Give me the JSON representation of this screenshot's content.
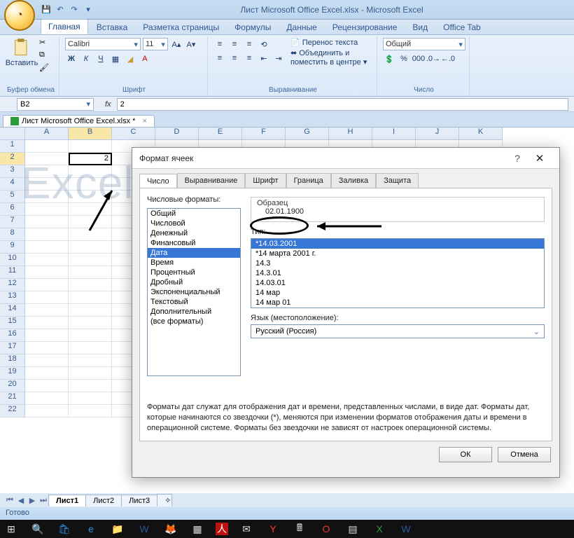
{
  "app": {
    "title": "Лист Microsoft Office Excel.xlsx - Microsoft Excel"
  },
  "ribbon": {
    "tabs": [
      "Главная",
      "Вставка",
      "Разметка страницы",
      "Формулы",
      "Данные",
      "Рецензирование",
      "Вид",
      "Office Tab"
    ],
    "active_tab": "Главная",
    "groups": {
      "clipboard": {
        "label": "Буфер обмена",
        "paste_label": "Вставить"
      },
      "font": {
        "label": "Шрифт",
        "font_name": "Calibri",
        "font_size": "11"
      },
      "alignment": {
        "label": "Выравнивание",
        "wrap_label": "Перенос текста",
        "merge_label": "Объединить и поместить в центре"
      },
      "number": {
        "label": "Число",
        "format": "Общий"
      }
    }
  },
  "formula_bar": {
    "name_box": "B2",
    "fx_label": "fx",
    "value": "2"
  },
  "workbook_tab": "Лист Microsoft Office Excel.xlsx *",
  "grid": {
    "columns": [
      "A",
      "B",
      "C",
      "D",
      "E",
      "F",
      "G",
      "H",
      "I",
      "J",
      "K"
    ],
    "row_count": 22,
    "selected_cell": {
      "row": 2,
      "col": "B",
      "value": "2"
    }
  },
  "dialog": {
    "title": "Формат ячеек",
    "tabs": [
      "Число",
      "Выравнивание",
      "Шрифт",
      "Граница",
      "Заливка",
      "Защита"
    ],
    "active_tab": "Число",
    "formats_label": "Числовые форматы:",
    "formats": [
      "Общий",
      "Числовой",
      "Денежный",
      "Финансовый",
      "Дата",
      "Время",
      "Процентный",
      "Дробный",
      "Экспоненциальный",
      "Текстовый",
      "Дополнительный",
      "(все форматы)"
    ],
    "selected_format": "Дата",
    "sample_label": "Образец",
    "sample_value": "02.01.1900",
    "type_label": "Тип:",
    "types": [
      "*14.03.2001",
      "*14 марта 2001 г.",
      "14.3",
      "14.3.01",
      "14.03.01",
      "14 мар",
      "14 мар 01"
    ],
    "selected_type": "*14.03.2001",
    "language_label": "Язык (местоположение):",
    "language_value": "Русский (Россия)",
    "description": "Форматы дат служат для отображения дат и времени, представленных числами, в виде дат. Форматы дат, которые начинаются со звездочки (*), меняются при изменении форматов отображения даты и времени в операционной системе. Форматы без звездочки не зависят от настроек операционной системы.",
    "ok_label": "ОК",
    "cancel_label": "Отмена"
  },
  "sheets": {
    "tabs": [
      "Лист1",
      "Лист2",
      "Лист3"
    ],
    "active": "Лист1"
  },
  "status": "Готово",
  "watermark": "Excel-helper.ru"
}
